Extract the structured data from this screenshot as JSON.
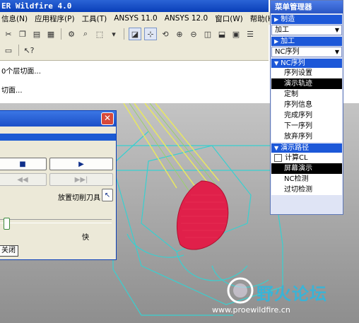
{
  "window": {
    "title": "ER Wildfire 4.0"
  },
  "menubar": [
    "信息(N)",
    "应用程序(P)",
    "工具(T)",
    "ANSYS 11.0",
    "ANSYS 12.0",
    "窗口(W)",
    "帮助(H)"
  ],
  "messages": [
    "0个层切面...",
    "切面..."
  ],
  "dialog": {
    "close_icon": "✕",
    "place_tool_label": "放置切削刀具",
    "fast_label": "快",
    "close_label": "关闭"
  },
  "menu_manager": {
    "title": "菜单管理器",
    "manufacture_header": "制造",
    "manufacture_dropdown": "加工",
    "machining_header": "加工",
    "machining_dropdown": "NC序列",
    "nc_sequence_header": "NC序列",
    "nc_items": [
      {
        "label": "序列设置",
        "selected": false
      },
      {
        "label": "演示轨迹",
        "selected": true
      },
      {
        "label": "定制",
        "selected": false
      },
      {
        "label": "序列信息",
        "selected": false
      },
      {
        "label": "完成序列",
        "selected": false
      },
      {
        "label": "下一序列",
        "selected": false
      },
      {
        "label": "放弃序列",
        "selected": false
      }
    ],
    "play_path_header": "演示路径",
    "play_path_items": [
      {
        "label": "计算CL",
        "type": "checkbox"
      },
      {
        "label": "屏幕演示",
        "selected": true
      },
      {
        "label": "NC检测",
        "selected": false
      },
      {
        "label": "过切检测",
        "selected": false
      }
    ]
  },
  "watermark": {
    "text": "野火论坛",
    "url": "www.proewildfire.cn"
  },
  "colors": {
    "title_blue": "#0a3fb8",
    "selected_bg": "#000000",
    "cut_red": "#e0204a",
    "wire_cyan": "#38d0d0",
    "tool_yellow": "#e8e860"
  }
}
